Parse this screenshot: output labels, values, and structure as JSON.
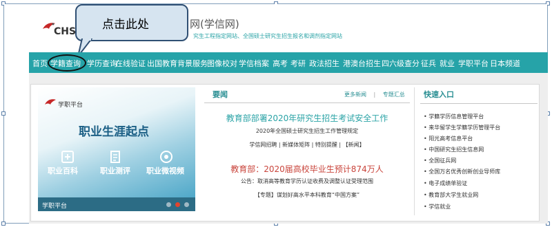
{
  "header": {
    "logo_text": "CHS",
    "site_title": "网(学信网)",
    "site_subtitle": "究生工程指定网站、全国硕士研究生招生报名和调剂指定网站"
  },
  "callout": {
    "text": "点击此处"
  },
  "nav": {
    "items": [
      "首页",
      "学籍查询",
      "学历查询",
      "在线验证",
      "出国教育背景服务",
      "图像校对",
      "学信档案",
      "高考",
      "考研",
      "政法招生",
      "港澳台招生",
      "四六级查分",
      "征兵",
      "就业",
      "学职平台",
      "日本频道"
    ],
    "highlighted": "学籍查询"
  },
  "banner": {
    "brand": "学职平台",
    "title": "职业生涯起点",
    "features": [
      "职业百科",
      "职业测评",
      "职业微视频"
    ],
    "footer_label": "学职平台"
  },
  "news": {
    "title": "要闻",
    "more_link": "更多新闻",
    "topics_link": "专题汇总",
    "headline1": "教育部部署2020年研究生招生考试安全工作",
    "sub1": "2020年全国硕士研究生招生工作管理规定",
    "sub2": "学信网招聘 | 新媒体矩阵 | 特别提醒 | 【新闻】",
    "headline2": "教育部：2020届高校毕业生预计874万人",
    "sub3": "公告：取消高等教育学历认证收费及调整认证受理范围",
    "sub4": "【专题】谋划好高水平本科教育“中国方案”"
  },
  "quick": {
    "title": "快速入口",
    "items": [
      "学籍学历信息管理平台",
      "来华留学生学籍学历管理平台",
      "阳光高考信息平台",
      "中国研究生招生信息网",
      "全国征兵网",
      "全国万名优秀创新创业导师库",
      "电子成绩单验证",
      "教育部大学生就业网",
      "学信就业"
    ]
  },
  "colors": {
    "nav_bg": "#26a3a8",
    "accent": "#2aa3a6",
    "headline_red": "#c9443b"
  }
}
